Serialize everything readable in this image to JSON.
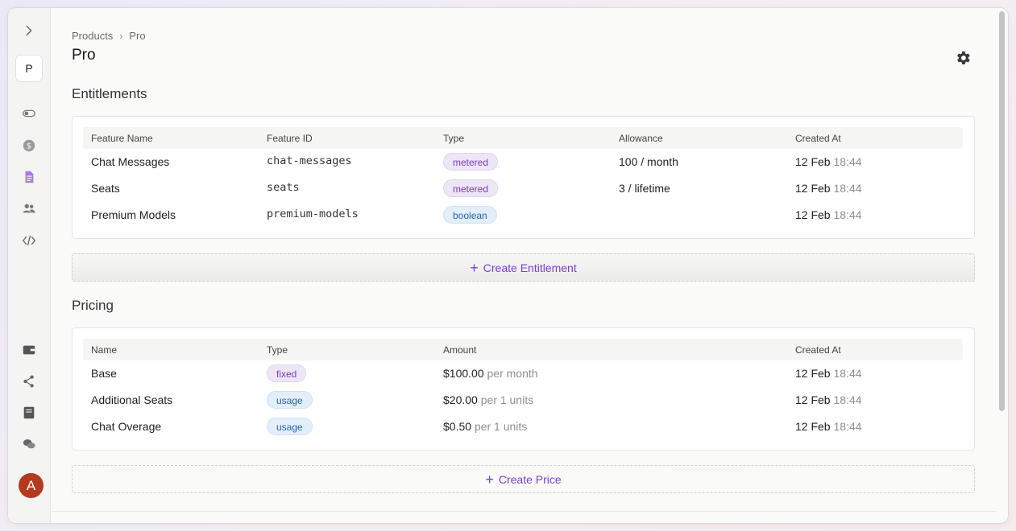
{
  "sidebar": {
    "project_letter": "P",
    "avatar_letter": "A",
    "accent": "#8b5cf6"
  },
  "breadcrumb": {
    "parent": "Products",
    "separator": "›",
    "current": "Pro"
  },
  "page": {
    "title": "Pro"
  },
  "entitlements": {
    "title": "Entitlements",
    "columns": [
      "Feature Name",
      "Feature ID",
      "Type",
      "Allowance",
      "Created At"
    ],
    "rows": [
      {
        "name": "Chat Messages",
        "id": "chat-messages",
        "type": "metered",
        "allowance": "100 / month",
        "date": "12 Feb",
        "time": "18:44"
      },
      {
        "name": "Seats",
        "id": "seats",
        "type": "metered",
        "allowance": "3 / lifetime",
        "date": "12 Feb",
        "time": "18:44"
      },
      {
        "name": "Premium Models",
        "id": "premium-models",
        "type": "boolean",
        "allowance": "",
        "date": "12 Feb",
        "time": "18:44"
      }
    ],
    "create_label": "Create Entitlement"
  },
  "pricing": {
    "title": "Pricing",
    "columns": [
      "Name",
      "Type",
      "Amount",
      "Created At"
    ],
    "rows": [
      {
        "name": "Base",
        "type": "fixed",
        "amount": "$100.00",
        "unit": "per month",
        "date": "12 Feb",
        "time": "18:44"
      },
      {
        "name": "Additional Seats",
        "type": "usage",
        "amount": "$20.00",
        "unit": "per 1 units",
        "date": "12 Feb",
        "time": "18:44"
      },
      {
        "name": "Chat Overage",
        "type": "usage",
        "amount": "$0.50",
        "unit": "per 1 units",
        "date": "12 Feb",
        "time": "18:44"
      }
    ],
    "create_label": "Create Price"
  }
}
